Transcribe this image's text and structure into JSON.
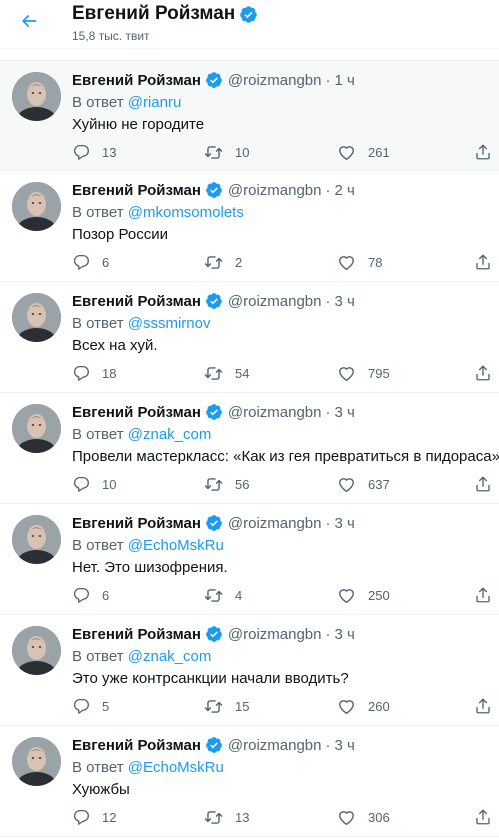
{
  "header": {
    "name": "Евгений Ройзман",
    "tweet_count": "15,8 тыс. твит",
    "back_icon": "arrow-left-icon"
  },
  "colors": {
    "accent": "#1d9bf0",
    "secondary_text": "#536471",
    "primary_text": "#0f1419"
  },
  "tweets": [
    {
      "name": "Евгений Ройзман",
      "handle": "@roizmangbn",
      "separator": "·",
      "time": "1 ч",
      "reply_prefix": "В ответ",
      "reply_to": "@rianru",
      "text": "Хуйню не городите",
      "replies": "13",
      "retweets": "10",
      "likes": "261"
    },
    {
      "name": "Евгений Ройзман",
      "handle": "@roizmangbn",
      "separator": "·",
      "time": "2 ч",
      "reply_prefix": "В ответ",
      "reply_to": "@mkomsomolets",
      "text": "Позор России",
      "replies": "6",
      "retweets": "2",
      "likes": "78"
    },
    {
      "name": "Евгений Ройзман",
      "handle": "@roizmangbn",
      "separator": "·",
      "time": "3 ч",
      "reply_prefix": "В ответ",
      "reply_to": "@sssmirnov",
      "text": "Всех на хуй.",
      "replies": "18",
      "retweets": "54",
      "likes": "795"
    },
    {
      "name": "Евгений Ройзман",
      "handle": "@roizmangbn",
      "separator": "·",
      "time": "3 ч",
      "reply_prefix": "В ответ",
      "reply_to": "@znak_com",
      "text": "Провели мастеркласс: «Как из гея превратиться в пидораса»",
      "replies": "10",
      "retweets": "56",
      "likes": "637"
    },
    {
      "name": "Евгений Ройзман",
      "handle": "@roizmangbn",
      "separator": "·",
      "time": "3 ч",
      "reply_prefix": "В ответ",
      "reply_to": "@EchoMskRu",
      "text": "Нет. Это шизофрения.",
      "replies": "6",
      "retweets": "4",
      "likes": "250"
    },
    {
      "name": "Евгений Ройзман",
      "handle": "@roizmangbn",
      "separator": "·",
      "time": "3 ч",
      "reply_prefix": "В ответ",
      "reply_to": "@znak_com",
      "text": "Это уже контрсанкции начали вводить?",
      "replies": "5",
      "retweets": "15",
      "likes": "260"
    },
    {
      "name": "Евгений Ройзман",
      "handle": "@roizmangbn",
      "separator": "·",
      "time": "3 ч",
      "reply_prefix": "В ответ",
      "reply_to": "@EchoMskRu",
      "text": "Хуюжбы",
      "replies": "12",
      "retweets": "13",
      "likes": "306"
    }
  ]
}
